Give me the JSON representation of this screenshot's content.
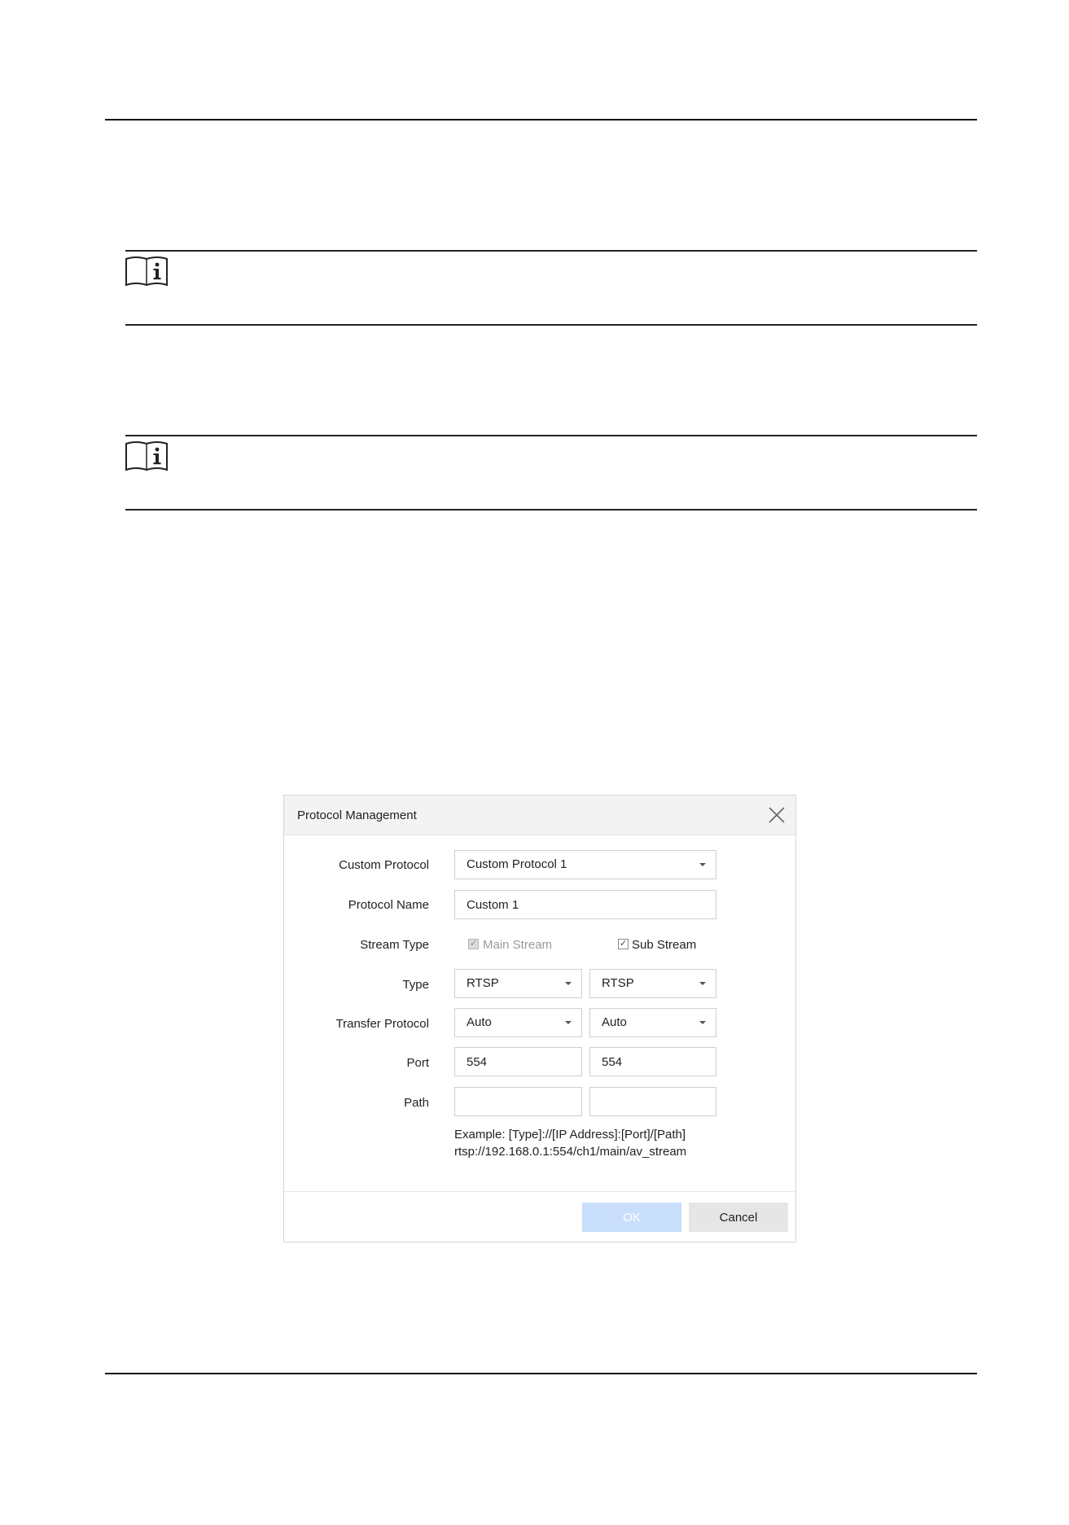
{
  "dialog": {
    "title": "Protocol Management",
    "fields": {
      "custom_protocol_label": "Custom Protocol",
      "custom_protocol_value": "Custom Protocol 1",
      "protocol_name_label": "Protocol Name",
      "protocol_name_value": "Custom 1",
      "stream_type_label": "Stream Type",
      "main_stream_label": "Main Stream",
      "main_stream_checked": true,
      "main_stream_disabled": true,
      "sub_stream_label": "Sub Stream",
      "sub_stream_checked": true,
      "type_label": "Type",
      "type_main": "RTSP",
      "type_sub": "RTSP",
      "transfer_protocol_label": "Transfer Protocol",
      "transfer_main": "Auto",
      "transfer_sub": "Auto",
      "port_label": "Port",
      "port_main": "554",
      "port_sub": "554",
      "path_label": "Path",
      "path_main": "",
      "path_sub": ""
    },
    "example_line1": "Example: [Type]://[IP Address]:[Port]/[Path]",
    "example_line2": "rtsp://192.168.0.1:554/ch1/main/av_stream",
    "ok_label": "OK",
    "cancel_label": "Cancel"
  },
  "colors": {
    "ok_button_bg": "#c8defa",
    "cancel_button_bg": "#e6e6e6",
    "header_bg": "#f3f3f3"
  }
}
